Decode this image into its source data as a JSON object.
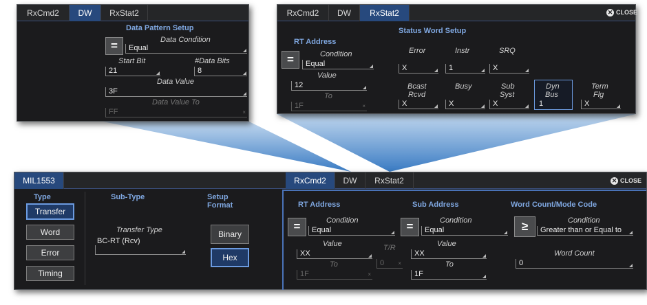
{
  "close_label": "CLOSE",
  "close_glyph": "✕",
  "tabs": {
    "rxcmd2": "RxCmd2",
    "dw": "DW",
    "rxstat2": "RxStat2",
    "mil": "MIL1553"
  },
  "dw_popup": {
    "title": "Data Pattern Setup",
    "equals": "=",
    "data_condition_label": "Data Condition",
    "data_condition": "Equal",
    "start_bit_label": "Start Bit",
    "start_bit": "21",
    "num_bits_label": "#Data Bits",
    "num_bits": "8",
    "data_value_label": "Data Value",
    "data_value": "3F",
    "data_value_to_label": "Data Value To",
    "data_value_to": "FF"
  },
  "rxstat2_popup": {
    "rt_title": "RT Address",
    "status_title": "Status Word Setup",
    "equals": "=",
    "condition_label": "Condition",
    "condition": "Equal",
    "value_label": "Value",
    "value": "12",
    "to_label": "To",
    "to_value": "1F",
    "bits": [
      {
        "label1": "Error",
        "label2": "",
        "value": "X"
      },
      {
        "label1": "Instr",
        "label2": "",
        "value": "1"
      },
      {
        "label1": "SRQ",
        "label2": "",
        "value": "X"
      },
      {
        "label1": "Bcast",
        "label2": "Rcvd",
        "value": "X"
      },
      {
        "label1": "Busy",
        "label2": "",
        "value": "X"
      },
      {
        "label1": "Sub",
        "label2": "Syst",
        "value": "X"
      },
      {
        "label1": "Dyn",
        "label2": "Bus",
        "value": "1"
      },
      {
        "label1": "Term",
        "label2": "Flg",
        "value": "X"
      }
    ]
  },
  "main": {
    "type_header": "Type",
    "type_buttons": [
      "Transfer",
      "Word",
      "Error",
      "Timing"
    ],
    "subtype_header": "Sub-Type",
    "transfer_type_label": "Transfer Type",
    "transfer_type": "BC-RT (Rcv)",
    "setup_header_1": "Setup",
    "setup_header_2": "Format",
    "binary": "Binary",
    "hex": "Hex",
    "rt": {
      "title": "RT Address",
      "equals": "=",
      "condition_label": "Condition",
      "condition": "Equal",
      "value_label": "Value",
      "value": "XX",
      "to_label": "To",
      "to_value": "1F"
    },
    "tr": {
      "label": "T/R",
      "value": "0"
    },
    "sa": {
      "title": "Sub Address",
      "equals": "=",
      "condition_label": "Condition",
      "condition": "Equal",
      "value_label": "Value",
      "value": "XX",
      "to_label": "To",
      "to_value": "1F"
    },
    "wc": {
      "title": "Word Count/Mode Code",
      "symbol": "≥",
      "condition_label": "Condition",
      "condition": "Greater than  or Equal to",
      "count_label": "Word Count",
      "count": "0"
    }
  }
}
